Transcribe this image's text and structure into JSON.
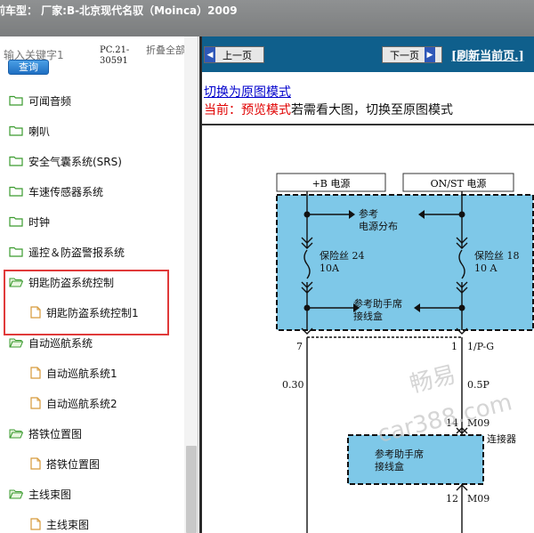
{
  "window": {
    "title": "前车型：  厂家:B-北京现代名驭（Moinca）2009"
  },
  "sidebar": {
    "search_placeholder": "输入关键字1",
    "search_button": "查询",
    "code": "PC.21-30591",
    "collapse_all": "折叠全部",
    "items": [
      {
        "label": "可闻音频",
        "type": "folder"
      },
      {
        "label": "喇叭",
        "type": "folder"
      },
      {
        "label": "安全气囊系统(SRS)",
        "type": "folder"
      },
      {
        "label": "车速传感器系统",
        "type": "folder"
      },
      {
        "label": "时钟",
        "type": "folder"
      },
      {
        "label": "遥控＆防盗警报系统",
        "type": "folder"
      },
      {
        "label": "钥匙防盗系统控制",
        "type": "folder-open"
      },
      {
        "label": "钥匙防盗系统控制1",
        "type": "doc"
      },
      {
        "label": "自动巡航系统",
        "type": "folder-open"
      },
      {
        "label": "自动巡航系统1",
        "type": "doc"
      },
      {
        "label": "自动巡航系统2",
        "type": "doc"
      },
      {
        "label": "搭铁位置图",
        "type": "folder-open"
      },
      {
        "label": "搭铁位置图",
        "type": "doc"
      },
      {
        "label": "主线束图",
        "type": "folder-open"
      },
      {
        "label": "主线束图",
        "type": "doc"
      }
    ]
  },
  "content": {
    "prev_button": "上一页",
    "next_button": "下一页",
    "refresh_link": "[刷新当前页.]",
    "switch_link": "切换为原图模式",
    "mode_current": "当前：预览模式",
    "mode_hint": "若需看大图，切换至原图模式"
  },
  "diagram": {
    "header_left": "+B 电源",
    "header_right": "ON/ST 电源",
    "ref_power_1": "参考",
    "ref_power_2": "电源分布",
    "fuse_left_1": "保险丝 24",
    "fuse_left_2": "10A",
    "fuse_right_1": "保险丝 18",
    "fuse_right_2": "10 A",
    "junction_1": "参考助手席",
    "junction_2": "接线盒",
    "pin_left": "7",
    "pin_right": "1",
    "pin_right_color": "1/P-G",
    "wire_left": "0.30",
    "wire_right": "0.5P",
    "conn_pin": "14",
    "conn_name": "M09",
    "connector_label": "连接器",
    "junction2_1": "参考助手席",
    "junction2_2": "接线盒",
    "bottom_pin": "12",
    "bottom_conn": "M09",
    "fill_color": "#7ec8e8"
  },
  "watermark": {
    "line1": "畅易",
    "line2": "car388.com"
  }
}
